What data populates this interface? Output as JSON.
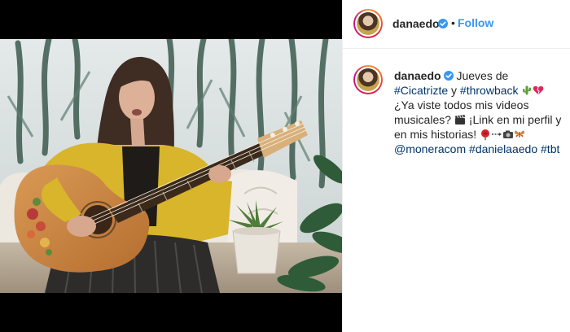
{
  "post": {
    "author": {
      "username": "danaedo",
      "verified": true
    },
    "header": {
      "separator": "•",
      "follow_label": "Follow"
    },
    "caption": {
      "part1": "Jueves de ",
      "tag_cicatrizte": "#Cicatrizte",
      "part2": " y ",
      "tag_throwback": "#throwback",
      "part3": " ¿Ya viste todos mis videos musicales? ",
      "part4": " ¡Link en mi perfil y en mis historias! ",
      "mention": "@moneracom",
      "tag_danielaaedo": "#danielaaedo",
      "tag_tbt": "#tbt"
    }
  },
  "media": {
    "type": "video"
  },
  "icons": {
    "verified": "verified-badge-icon",
    "cactus": "cactus-emoji-icon",
    "heart": "broken-heart-emoji-icon",
    "clapper": "clapper-board-emoji-icon",
    "rose": "rose-emoji-icon",
    "camera": "camera-emoji-icon",
    "butterfly": "butterfly-emoji-icon"
  },
  "colors": {
    "link": "#003569",
    "follow": "#3897f0",
    "verified": "#3897f0",
    "text": "#262626"
  }
}
